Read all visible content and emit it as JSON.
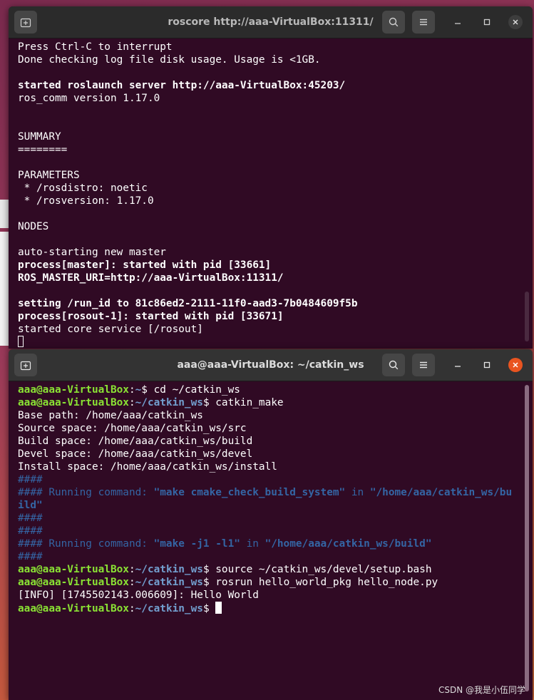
{
  "top_window": {
    "title": "roscore http://aaa-VirtualBox:11311/",
    "lines": [
      {
        "segments": [
          {
            "t": "Press Ctrl-C to interrupt",
            "s": ""
          }
        ]
      },
      {
        "segments": [
          {
            "t": "Done checking log file disk usage. Usage is <1GB.",
            "s": ""
          }
        ]
      },
      {
        "segments": [
          {
            "t": "",
            "s": ""
          }
        ]
      },
      {
        "segments": [
          {
            "t": "started roslaunch server http://aaa-VirtualBox:45203/",
            "s": "b"
          }
        ]
      },
      {
        "segments": [
          {
            "t": "ros_comm version 1.17.0",
            "s": ""
          }
        ]
      },
      {
        "segments": [
          {
            "t": "",
            "s": ""
          }
        ]
      },
      {
        "segments": [
          {
            "t": "",
            "s": ""
          }
        ]
      },
      {
        "segments": [
          {
            "t": "SUMMARY",
            "s": ""
          }
        ]
      },
      {
        "segments": [
          {
            "t": "========",
            "s": ""
          }
        ]
      },
      {
        "segments": [
          {
            "t": "",
            "s": ""
          }
        ]
      },
      {
        "segments": [
          {
            "t": "PARAMETERS",
            "s": ""
          }
        ]
      },
      {
        "segments": [
          {
            "t": " * /rosdistro: noetic",
            "s": ""
          }
        ]
      },
      {
        "segments": [
          {
            "t": " * /rosversion: 1.17.0",
            "s": ""
          }
        ]
      },
      {
        "segments": [
          {
            "t": "",
            "s": ""
          }
        ]
      },
      {
        "segments": [
          {
            "t": "NODES",
            "s": ""
          }
        ]
      },
      {
        "segments": [
          {
            "t": "",
            "s": ""
          }
        ]
      },
      {
        "segments": [
          {
            "t": "auto-starting new master",
            "s": ""
          }
        ]
      },
      {
        "segments": [
          {
            "t": "process[master]: started with pid [33661]",
            "s": "b"
          }
        ]
      },
      {
        "segments": [
          {
            "t": "ROS_MASTER_URI=http://aaa-VirtualBox:11311/",
            "s": "b"
          }
        ]
      },
      {
        "segments": [
          {
            "t": "",
            "s": ""
          }
        ]
      },
      {
        "segments": [
          {
            "t": "setting /run_id to 81c86ed2-2111-11f0-aad3-7b0484609f5b",
            "s": "b"
          }
        ]
      },
      {
        "segments": [
          {
            "t": "process[rosout-1]: started with pid [33671]",
            "s": "b"
          }
        ]
      },
      {
        "segments": [
          {
            "t": "started core service [/rosout]",
            "s": ""
          }
        ]
      }
    ]
  },
  "bottom_window": {
    "title": "aaa@aaa-VirtualBox: ~/catkin_ws",
    "lines": [
      {
        "segments": [
          {
            "t": "aaa@aaa-VirtualBox",
            "s": "g"
          },
          {
            "t": ":",
            "s": ""
          },
          {
            "t": "~",
            "s": "bl"
          },
          {
            "t": "$ cd ~/catkin_ws",
            "s": ""
          }
        ]
      },
      {
        "segments": [
          {
            "t": "aaa@aaa-VirtualBox",
            "s": "g"
          },
          {
            "t": ":",
            "s": ""
          },
          {
            "t": "~/catkin_ws",
            "s": "bl"
          },
          {
            "t": "$ catkin_make",
            "s": ""
          }
        ]
      },
      {
        "segments": [
          {
            "t": "Base path: /home/aaa/catkin_ws",
            "s": ""
          }
        ]
      },
      {
        "segments": [
          {
            "t": "Source space: /home/aaa/catkin_ws/src",
            "s": ""
          }
        ]
      },
      {
        "segments": [
          {
            "t": "Build space: /home/aaa/catkin_ws/build",
            "s": ""
          }
        ]
      },
      {
        "segments": [
          {
            "t": "Devel space: /home/aaa/catkin_ws/devel",
            "s": ""
          }
        ]
      },
      {
        "segments": [
          {
            "t": "Install space: /home/aaa/catkin_ws/install",
            "s": ""
          }
        ]
      },
      {
        "segments": [
          {
            "t": "####",
            "s": "hb"
          }
        ]
      },
      {
        "segments": [
          {
            "t": "#### Running command: ",
            "s": "hb"
          },
          {
            "t": "\"make cmake_check_build_system\"",
            "s": "hbb"
          },
          {
            "t": " in ",
            "s": "hb"
          },
          {
            "t": "\"/home/aaa/catkin_ws/bu",
            "s": "hbb"
          }
        ]
      },
      {
        "segments": [
          {
            "t": "ild\"",
            "s": "hbb"
          }
        ]
      },
      {
        "segments": [
          {
            "t": "####",
            "s": "hb"
          }
        ]
      },
      {
        "segments": [
          {
            "t": "####",
            "s": "hb"
          }
        ]
      },
      {
        "segments": [
          {
            "t": "#### Running command: ",
            "s": "hb"
          },
          {
            "t": "\"make -j1 -l1\"",
            "s": "hbb"
          },
          {
            "t": " in ",
            "s": "hb"
          },
          {
            "t": "\"/home/aaa/catkin_ws/build\"",
            "s": "hbb"
          }
        ]
      },
      {
        "segments": [
          {
            "t": "####",
            "s": "hb"
          }
        ]
      },
      {
        "segments": [
          {
            "t": "aaa@aaa-VirtualBox",
            "s": "g"
          },
          {
            "t": ":",
            "s": ""
          },
          {
            "t": "~/catkin_ws",
            "s": "bl"
          },
          {
            "t": "$ source ~/catkin_ws/devel/setup.bash",
            "s": ""
          }
        ]
      },
      {
        "segments": [
          {
            "t": "aaa@aaa-VirtualBox",
            "s": "g"
          },
          {
            "t": ":",
            "s": ""
          },
          {
            "t": "~/catkin_ws",
            "s": "bl"
          },
          {
            "t": "$ rosrun hello_world_pkg hello_node.py",
            "s": ""
          }
        ]
      },
      {
        "segments": [
          {
            "t": "[INFO] [1745502143.006609]: Hello World",
            "s": ""
          }
        ]
      },
      {
        "segments": [
          {
            "t": "aaa@aaa-VirtualBox",
            "s": "g"
          },
          {
            "t": ":",
            "s": ""
          },
          {
            "t": "~/catkin_ws",
            "s": "bl"
          },
          {
            "t": "$ ",
            "s": ""
          }
        ]
      }
    ]
  },
  "watermark": "CSDN @我是小伍同学",
  "colors": {
    "terminal_bg": "#300a24",
    "prompt_user": "#8ae234",
    "prompt_path": "#729fcf",
    "hash_text": "#3465a4",
    "close_active": "#e95420"
  },
  "icons": [
    "new-tab-icon",
    "search-icon",
    "menu-icon",
    "minimize-icon",
    "maximize-icon",
    "close-icon"
  ]
}
